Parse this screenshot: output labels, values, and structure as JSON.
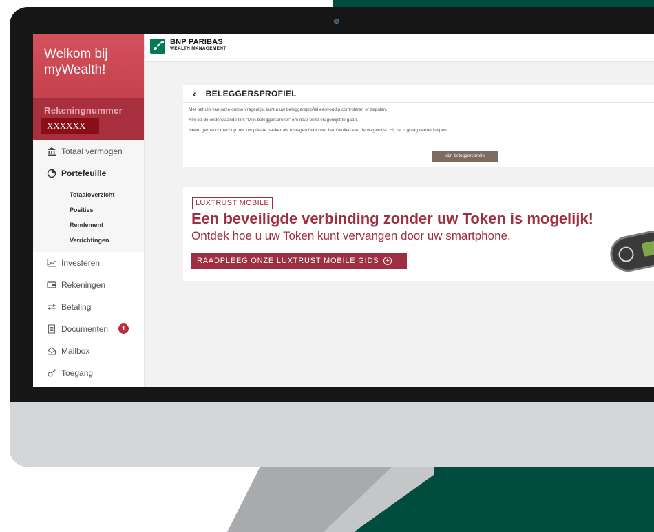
{
  "sidebar": {
    "welcome_line1": "Welkom bij",
    "welcome_line2": "myWealth!",
    "account_label": "Rekeningnummer",
    "account_number": "XXXXXX",
    "items": [
      {
        "label": "Totaal vermogen",
        "icon": "bank-icon"
      },
      {
        "label": "Portefeuille",
        "icon": "pie-chart-icon"
      },
      {
        "label": "Investeren",
        "icon": "line-chart-icon"
      },
      {
        "label": "Rekeningen",
        "icon": "wallet-icon"
      },
      {
        "label": "Betaling",
        "icon": "transfer-arrows-icon"
      },
      {
        "label": "Documenten",
        "icon": "document-icon",
        "badge": "1"
      },
      {
        "label": "Mailbox",
        "icon": "envelope-icon"
      },
      {
        "label": "Toegang",
        "icon": "key-icon"
      }
    ],
    "subitems": [
      "Totaaloverzicht",
      "Posities",
      "Rendement",
      "Verrichtingen"
    ]
  },
  "header": {
    "brand_line1": "BNP PARIBAS",
    "brand_line2": "WEALTH MANAGEMENT"
  },
  "profile_panel": {
    "title": "BELEGGERSPROFIEL",
    "lines": [
      "Met behulp van onze online vragenlijst kunt u uw beleggersprofiel eenvoudig controleren of bepalen.",
      "Klik op de onderstaande link \"Mijn beleggersprofiel\" om naar onze vragenlijst te gaan.",
      "Neem gerust contact op met uw private banker als u vragen hebt over het invullen van de vragenlijst. Hij zal u graag verder helpen."
    ],
    "button": "Mijn beleggersprofiel"
  },
  "banner": {
    "tag": "LUXTRUST MOBILE",
    "headline": "Een beveiligde verbinding zonder uw Token is mogelijk!",
    "subline": "Ontdek hoe u uw Token kunt vervangen door uw smartphone.",
    "button": "RAADPLEEG ONZE LUXTRUST MOBILE GIDS"
  },
  "colors": {
    "brand_red": "#c5414d",
    "account_red": "#8b0e17",
    "luxtrust_red": "#9d2f40",
    "bnp_green": "#007c52",
    "backdrop_green": "#004c3f",
    "button_brown": "#7c6b61"
  }
}
